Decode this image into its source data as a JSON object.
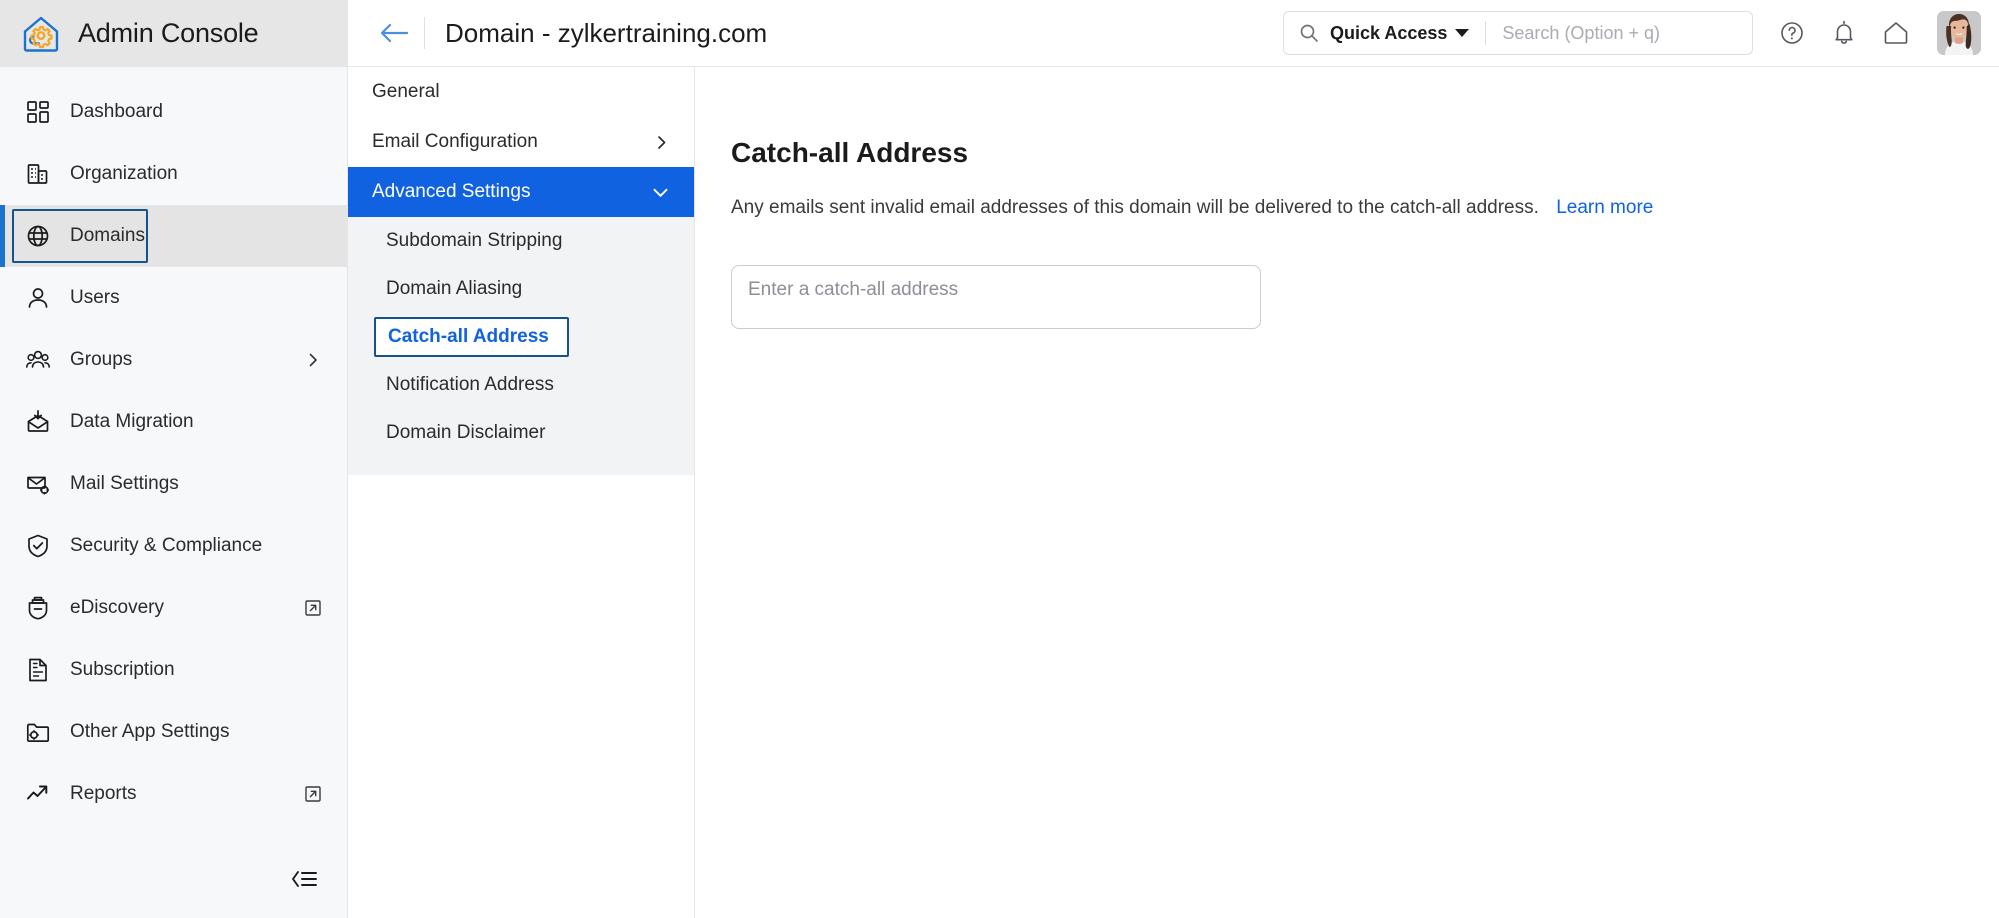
{
  "brand": {
    "title": "Admin Console",
    "logo_icon": "house-gear-icon",
    "logo_outline_color": "#1b73cd",
    "logo_gear_color": "#f5a623"
  },
  "sidebar": {
    "items": [
      {
        "label": "Dashboard",
        "icon": "grid-dashboard-icon",
        "trailing": ""
      },
      {
        "label": "Organization",
        "icon": "building-icon",
        "trailing": ""
      },
      {
        "label": "Domains",
        "icon": "globe-icon",
        "trailing": "",
        "active": true
      },
      {
        "label": "Users",
        "icon": "user-icon",
        "trailing": ""
      },
      {
        "label": "Groups",
        "icon": "users-group-icon",
        "trailing": "chevron-right-icon"
      },
      {
        "label": "Data Migration",
        "icon": "envelope-download-icon",
        "trailing": ""
      },
      {
        "label": "Mail Settings",
        "icon": "envelope-gear-icon",
        "trailing": ""
      },
      {
        "label": "Security & Compliance",
        "icon": "shield-check-icon",
        "trailing": ""
      },
      {
        "label": "eDiscovery",
        "icon": "briefcase-icon",
        "trailing": "external-link-icon"
      },
      {
        "label": "Subscription",
        "icon": "invoice-dollar-icon",
        "trailing": ""
      },
      {
        "label": "Other App Settings",
        "icon": "folder-gear-icon",
        "trailing": ""
      },
      {
        "label": "Reports",
        "icon": "trend-arrow-icon",
        "trailing": "external-link-icon"
      }
    ],
    "collapse_icon": "collapse-menu-icon",
    "active_accent_color": "#1b73cd",
    "active_bg_color": "#e4e4e4"
  },
  "topbar": {
    "back_icon": "back-arrow-icon",
    "title": "Domain - zylkertraining.com",
    "quick_access_label": "Quick Access",
    "quick_access_icon": "search-icon",
    "quick_access_caret": "chevron-down-icon",
    "search_placeholder": "Search (Option + q)",
    "search_value": "",
    "icons": [
      {
        "name": "help-icon"
      },
      {
        "name": "bell-icon"
      },
      {
        "name": "home-icon"
      }
    ],
    "avatar": "user-avatar-photo"
  },
  "subnav": {
    "items": [
      {
        "label": "General",
        "trailing": "",
        "state": "normal"
      },
      {
        "label": "Email Configuration",
        "trailing": "chevron-right-icon",
        "state": "normal"
      },
      {
        "label": "Advanced Settings",
        "trailing": "chevron-down-icon",
        "state": "selected"
      }
    ],
    "subitems": [
      {
        "label": "Subdomain Stripping",
        "state": "normal"
      },
      {
        "label": "Domain Aliasing",
        "state": "normal"
      },
      {
        "label": "Catch-all Address",
        "state": "active"
      },
      {
        "label": "Notification Address",
        "state": "normal"
      },
      {
        "label": "Domain Disclaimer",
        "state": "normal"
      }
    ],
    "selected_bg_color": "#1062e0",
    "active_text_color": "#1062e0"
  },
  "content": {
    "title": "Catch-all Address",
    "description": "Any emails sent invalid email addresses of this domain will be delivered to the catch-all address.",
    "learn_more_label": "Learn more",
    "input_placeholder": "Enter a catch-all address",
    "input_value": ""
  }
}
